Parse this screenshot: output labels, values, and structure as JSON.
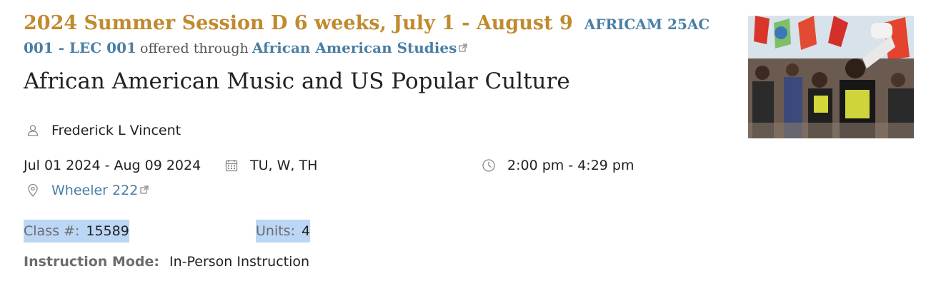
{
  "header": {
    "session": "2024 Summer Session D 6 weeks, July 1 - August 9",
    "course_code": "AFRICAM 25AC 001 - LEC 001",
    "offered_through": "offered through",
    "department": "African American Studies"
  },
  "course_title": "African American Music and US Popular Culture",
  "instructor": "Frederick L Vincent",
  "meeting": {
    "dates": "Jul 01 2024 - Aug 09 2024",
    "days": "TU, W, TH",
    "time": "2:00 pm - 4:29 pm",
    "location": "Wheeler 222"
  },
  "details": {
    "class_num_label": "Class #:",
    "class_num": "15589",
    "units_label": "Units:",
    "units": "4",
    "mode_label": "Instruction Mode:",
    "mode": "In-Person Instruction"
  },
  "colors": {
    "session_gold": "#c08a2e",
    "link_blue": "#4a7fa5",
    "selection_highlight": "#bcd6f5"
  },
  "icons": [
    "person-icon",
    "calendar-icon",
    "clock-icon",
    "map-pin-icon",
    "external-link-icon"
  ]
}
